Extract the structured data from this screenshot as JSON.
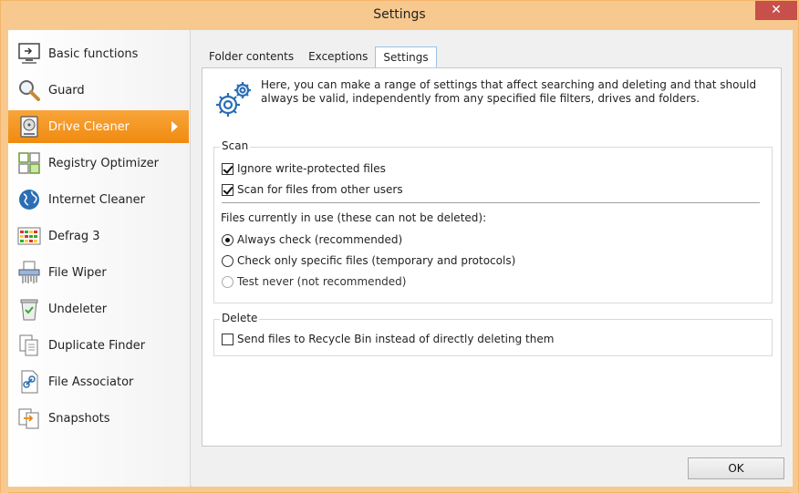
{
  "window": {
    "title": "Settings",
    "close_label": "✕"
  },
  "sidebar": {
    "items": [
      {
        "label": "Basic functions",
        "icon": "monitor-icon"
      },
      {
        "label": "Guard",
        "icon": "magnifier-icon"
      },
      {
        "label": "Drive Cleaner",
        "icon": "drive-icon",
        "active": true
      },
      {
        "label": "Registry Optimizer",
        "icon": "registry-icon"
      },
      {
        "label": "Internet Cleaner",
        "icon": "globe-icon"
      },
      {
        "label": "Defrag 3",
        "icon": "defrag-icon"
      },
      {
        "label": "File Wiper",
        "icon": "shredder-icon"
      },
      {
        "label": "Undeleter",
        "icon": "recycle-bin-icon"
      },
      {
        "label": "Duplicate Finder",
        "icon": "duplicate-icon"
      },
      {
        "label": "File Associator",
        "icon": "link-file-icon"
      },
      {
        "label": "Snapshots",
        "icon": "snapshot-icon"
      }
    ]
  },
  "tabs": [
    {
      "label": "Folder contents",
      "active": false
    },
    {
      "label": "Exceptions",
      "active": false
    },
    {
      "label": "Settings",
      "active": true
    }
  ],
  "intro": {
    "icon": "gears-icon",
    "text": "Here, you can make a range of settings that affect searching and deleting and that should always be valid, independently from any specified file filters, drives and folders."
  },
  "scan_group": {
    "title": "Scan",
    "ignore_write_protected": {
      "label": "Ignore write-protected files",
      "checked": true
    },
    "scan_other_users": {
      "label": "Scan for files from other users",
      "checked": true
    },
    "in_use_label": "Files currently in use (these can not be deleted):",
    "options": [
      {
        "label": "Always check (recommended)",
        "selected": true
      },
      {
        "label": "Check only specific files (temporary and protocols)",
        "selected": false
      },
      {
        "label": "Test never (not recommended)",
        "selected": false
      }
    ]
  },
  "delete_group": {
    "title": "Delete",
    "recycle_bin": {
      "label": "Send files to Recycle Bin instead of directly deleting them",
      "checked": false
    }
  },
  "ok_label": "OK",
  "colors": {
    "accent": "#f08a10",
    "titlebar": "#f8c98e",
    "close": "#c7504b"
  }
}
